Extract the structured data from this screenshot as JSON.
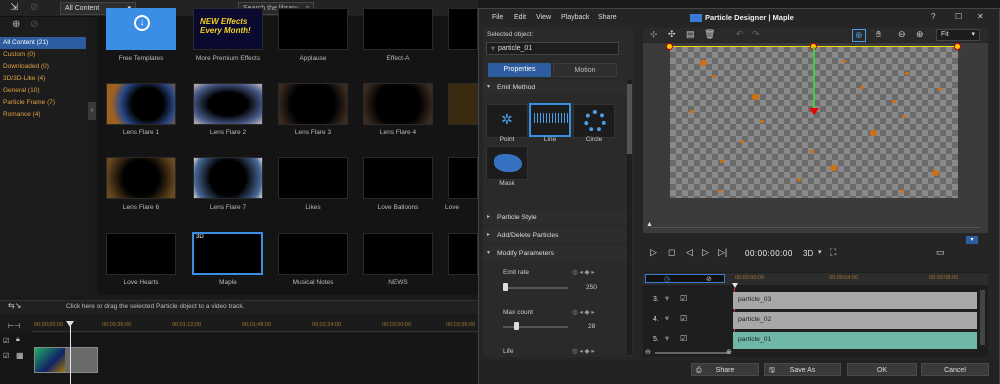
{
  "library": {
    "filter": "All Content",
    "search_placeholder": "Search the library",
    "categories": [
      "All Content (21)",
      "Custom (0)",
      "Downloaded (0)",
      "3D/3D-Like (4)",
      "General (10)",
      "Particle Frame (7)",
      "Romance (4)"
    ],
    "tiles": [
      {
        "label": "Free Templates",
        "ov": "Download"
      },
      {
        "label": "More Premium Effects",
        "ov": "NEW Effects\nEvery Month!"
      },
      {
        "label": "Applause"
      },
      {
        "label": "Effect-A"
      },
      {
        "label": "Lens Flare 1"
      },
      {
        "label": "Lens Flare 2"
      },
      {
        "label": "Lens Flare 3"
      },
      {
        "label": "Lens Flare 4"
      },
      {
        "label": "Lens Flare 6"
      },
      {
        "label": "Lens Flare 7"
      },
      {
        "label": "Likes"
      },
      {
        "label": "Love Balloons"
      },
      {
        "label": "Love Hearts"
      },
      {
        "label": "Maple",
        "ov": "3D"
      },
      {
        "label": "Musical Notes"
      },
      {
        "label": "NEWS"
      }
    ],
    "partial_labels": [
      "Love"
    ]
  },
  "timeline": {
    "hint": "Click here or drag the selected Particle object to a video track.",
    "ruler": [
      "00;00;00;00",
      "00;00;36;00",
      "00;01;12;00",
      "00;01;48;00",
      "00;02;24;00",
      "00;03;00;00",
      "00;03;36;00"
    ]
  },
  "designer": {
    "menu": [
      "File",
      "Edit",
      "View",
      "Playback",
      "Share"
    ],
    "title": "Particle Designer | Maple",
    "window_buttons": [
      "?",
      "☐",
      "✕"
    ],
    "selected_object_label": "Selected object:",
    "selected_object": "particle_01",
    "tabs": [
      "Properties",
      "Motion"
    ],
    "sections": {
      "emit_method": "Emit Method",
      "particle_style": "Particle Style",
      "add_delete": "Add/Delete Particles",
      "modify": "Modify Parameters"
    },
    "emit_methods": [
      "Point",
      "Line",
      "Circle",
      "Mask"
    ],
    "params": [
      {
        "label": "Emit rate",
        "value": "250",
        "position": 0.05
      },
      {
        "label": "Max count",
        "value": "28",
        "position": 0.17
      },
      {
        "label": "Life",
        "value": ""
      }
    ],
    "zoom": "Fit",
    "timecode": "00:00:00:00",
    "mode_3d": "3D",
    "mini_ruler": [
      "00:00:00:00",
      "00:00:04:00",
      "00:00:08:00"
    ],
    "tracks": [
      {
        "num": "3.",
        "name": "particle_03",
        "color": "#a8a8a8"
      },
      {
        "num": "4.",
        "name": "particle_02",
        "color": "#a8a8a8"
      },
      {
        "num": "5.",
        "name": "particle_01",
        "color": "#6fb8a8"
      }
    ],
    "buttons": {
      "share": "Share",
      "save_as": "Save As",
      "ok": "OK",
      "cancel": "Cancel"
    }
  }
}
